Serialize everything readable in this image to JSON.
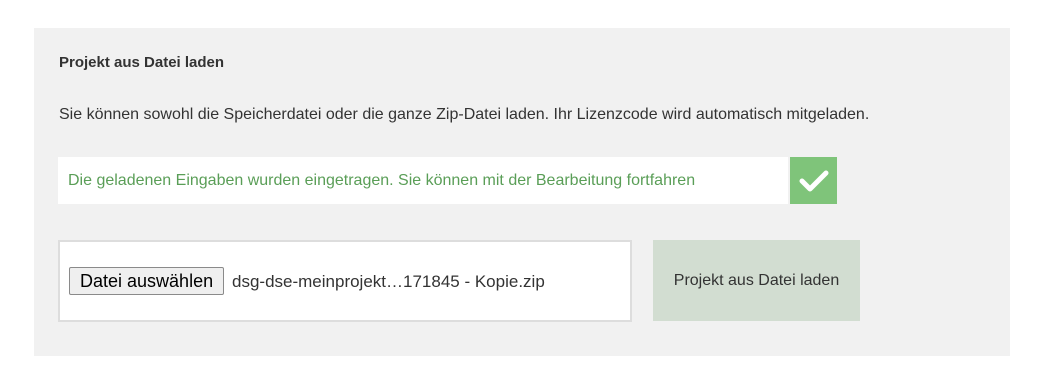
{
  "panel": {
    "title": "Projekt aus Datei laden",
    "description": "Sie können sowohl die Speicherdatei oder die ganze Zip-Datei laden. Ihr Lizenzcode wird automatisch mitgeladen."
  },
  "status": {
    "message": "Die geladenen Eingaben wurden eingetragen. Sie können mit der Bearbeitung fortfahren",
    "icon": "checkmark-icon",
    "color": "#5a9e57",
    "icon_background": "#7fc47a"
  },
  "file_input": {
    "button_label": "Datei auswählen",
    "selected_file": "dsg-dse-meinprojekt…171845 - Kopie.zip"
  },
  "load_button": {
    "label": "Projekt aus Datei laden",
    "background": "#d2ddd1"
  }
}
